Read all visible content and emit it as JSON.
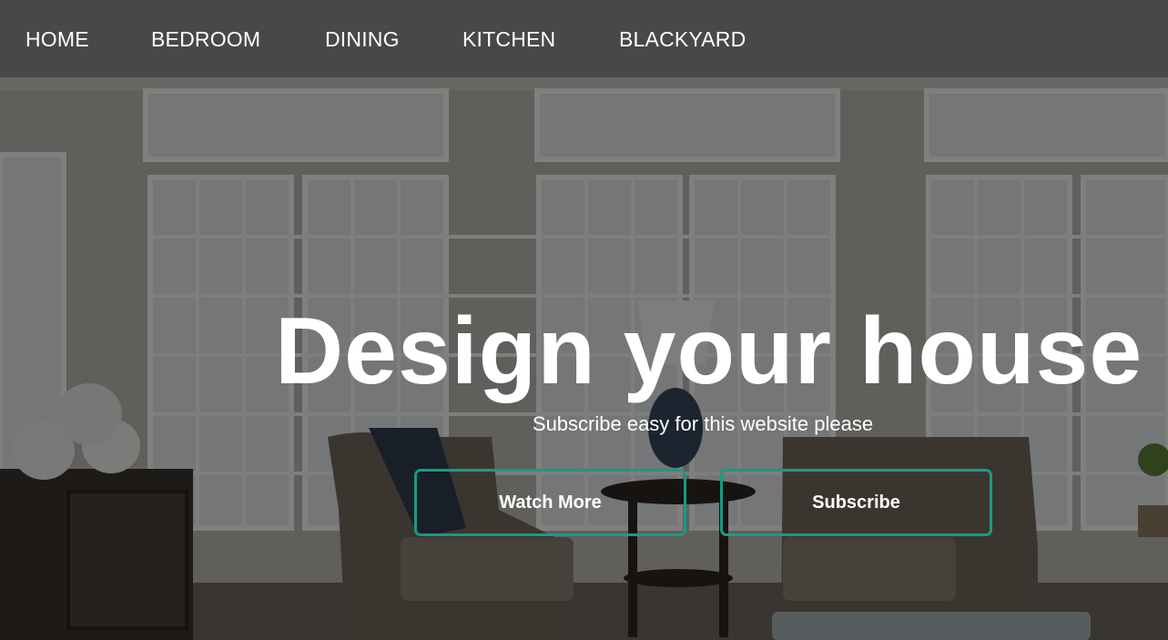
{
  "nav": {
    "items": [
      "HOME",
      "BEDROOM",
      "DINING",
      "KITCHEN",
      "BLACKYARD"
    ]
  },
  "hero": {
    "title": "Design your house",
    "subtitle": "Subscribe easy for this website please",
    "buttons": {
      "watch_more": "Watch More",
      "subscribe": "Subscribe"
    }
  },
  "colors": {
    "overlay": "#000000",
    "button_border": "#1a9a83",
    "text": "#ffffff"
  }
}
